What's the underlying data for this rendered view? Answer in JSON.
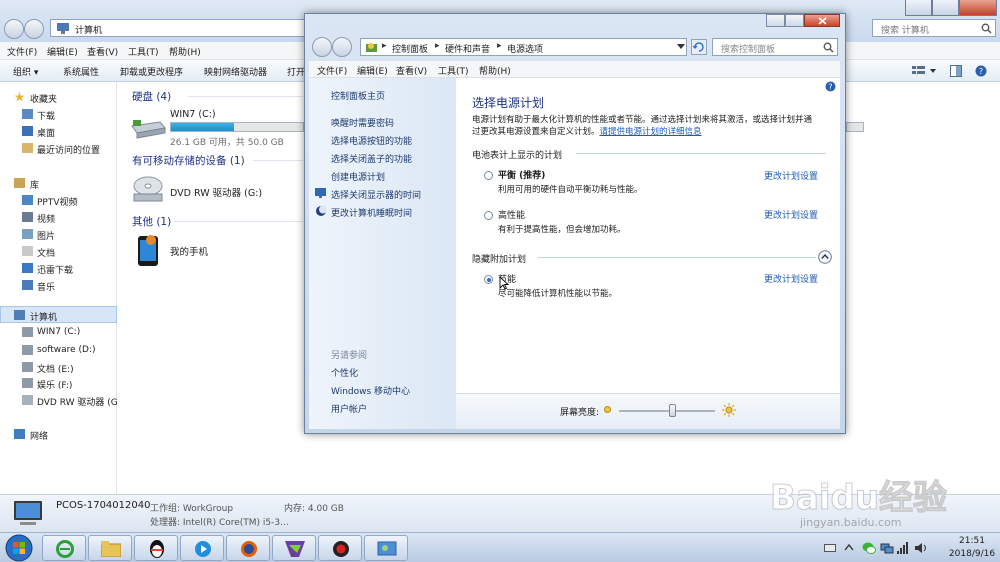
{
  "explorer": {
    "address": "计算机",
    "search_placeholder": "搜索 计算机",
    "menu": [
      "文件(F)",
      "编辑(E)",
      "查看(V)",
      "工具(T)",
      "帮助(H)"
    ],
    "toolbar": [
      "组织 ▾",
      "系统属性",
      "卸载或更改程序",
      "映射网络驱动器",
      "打开"
    ],
    "nav": {
      "favorites_header": "收藏夹",
      "favorites": [
        "下载",
        "桌面",
        "最近访问的位置"
      ],
      "libraries_header": "库",
      "libraries": [
        "PPTV视频",
        "视频",
        "图片",
        "文档",
        "迅雷下载",
        "音乐"
      ],
      "computer_header": "计算机",
      "drives": [
        "WIN7 (C:)",
        "software (D:)",
        "文档 (E:)",
        "娱乐 (F:)",
        "DVD RW 驱动器 (G"
      ],
      "network": "网络"
    },
    "groups": {
      "hdd": "硬盘 (4)",
      "removable": "有可移动存储的设备 (1)",
      "other": "其他 (1)"
    },
    "drive_c": {
      "name": "WIN7 (C:)",
      "free": "26.1 GB 可用，共 50.0 GB",
      "used_fraction": 0.48
    },
    "dvd": "DVD RW 驱动器 (G:)",
    "phone": "我的手机",
    "status": {
      "pc_name": "PCOS-1704012040",
      "workgroup": "工作组: WorkGroup",
      "memory": "内存: 4.00 GB",
      "cpu": "处理器: Intel(R) Core(TM) i5-3..."
    }
  },
  "control_panel": {
    "breadcrumb": [
      "控制面板",
      "硬件和声音",
      "电源选项"
    ],
    "search_placeholder": "搜索控制面板",
    "menu": [
      "文件(F)",
      "编辑(E)",
      "查看(V)",
      "工具(T)",
      "帮助(H)"
    ],
    "left_links": [
      "控制面板主页",
      "唤醒时需要密码",
      "选择电源按钮的功能",
      "选择关闭盖子的功能",
      "创建电源计划",
      "选择关闭显示器的时间",
      "更改计算机睡眠时间"
    ],
    "see_also_header": "另请参阅",
    "see_also": [
      "个性化",
      "Windows 移动中心",
      "用户帐户"
    ],
    "title": "选择电源计划",
    "desc1": "电源计划有助于最大化计算机的性能或者节能。通过选择计划来将其激活，或选择计划并通",
    "desc2_text": "过更改其电源设置来自定义计划。",
    "desc2_link": "请提供电源计划的详细信息",
    "section_battery": "电池表计上显示的计划",
    "plans": [
      {
        "name": "平衡 (推荐)",
        "desc": "利用可用的硬件自动平衡功耗与性能。",
        "link": "更改计划设置",
        "selected": false
      },
      {
        "name": "高性能",
        "desc": "有利于提高性能，但会增加功耗。",
        "link": "更改计划设置",
        "selected": false
      }
    ],
    "section_hidden": "隐藏附加计划",
    "hidden_plan": {
      "name": "节能",
      "desc": "尽可能降低计算机性能以节能。",
      "link": "更改计划设置",
      "selected": true
    },
    "brightness_label": "屏幕亮度:",
    "brightness_level": 0.55,
    "help_icon": "?"
  },
  "taskbar": {
    "time": "21:51",
    "date": "2018/9/16"
  },
  "watermark": {
    "brand": "Baidu经验",
    "url": "jingyan.baidu.com"
  },
  "colors": {
    "link": "#1e5bb3",
    "title": "#1e3287",
    "progress": "#1a8fc9"
  }
}
